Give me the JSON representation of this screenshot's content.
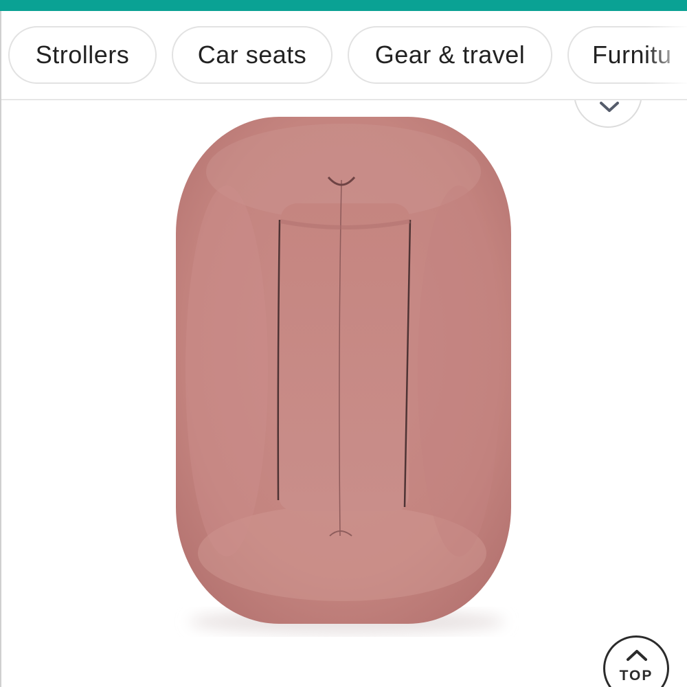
{
  "theme": {
    "accent": "#0aa294",
    "product_color": "#c68a88"
  },
  "category_chips": [
    {
      "label": "Strollers"
    },
    {
      "label": "Car seats"
    },
    {
      "label": "Gear & travel"
    },
    {
      "label": "Furnitu"
    }
  ],
  "expand_button": {
    "icon": "chevron-down-icon"
  },
  "product": {
    "image": "pink baby lounger"
  },
  "scroll_top": {
    "label": "TOP",
    "icon": "chevron-up-icon"
  }
}
